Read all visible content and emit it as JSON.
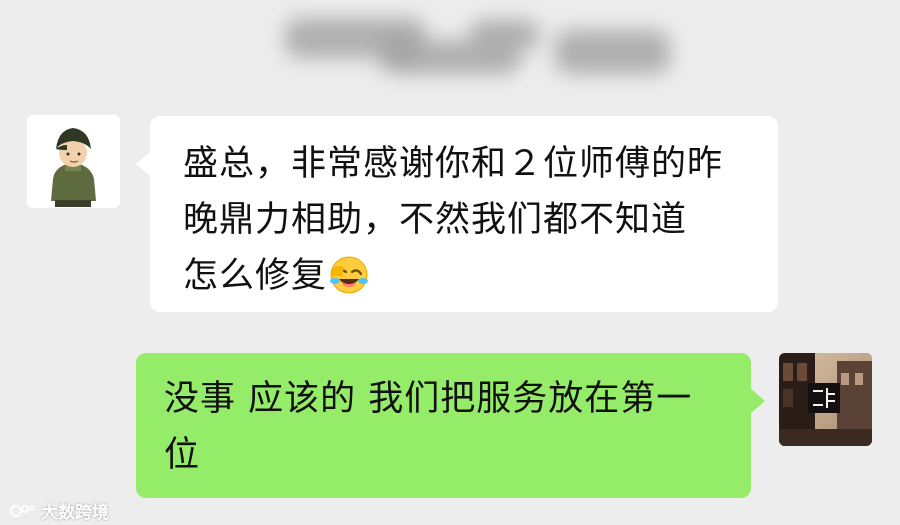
{
  "chat": {
    "messages": [
      {
        "sender": "other",
        "lines": [
          "盛总，非常感谢你和２位师傅的昨",
          "晚鼎力相助，不然我们都不知道",
          "怎么修复"
        ],
        "emoji": "laughing-crying-face"
      },
      {
        "sender": "self",
        "lines": [
          "没事 应该的 我们把服务放在第一",
          "位"
        ]
      }
    ]
  },
  "watermark": {
    "text": "大数跨境"
  },
  "colors": {
    "background": "#ededed",
    "incoming_bubble": "#ffffff",
    "outgoing_bubble": "#95ec69",
    "text": "#111111"
  }
}
